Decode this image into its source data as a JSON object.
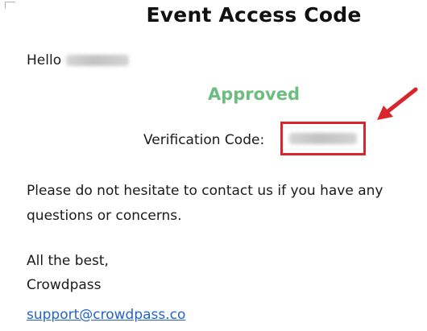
{
  "email": {
    "title": "Event Access Code",
    "greeting": "Hello",
    "recipient_name_redacted": true,
    "status": "Approved",
    "verification_label": "Verification Code:",
    "verification_code_redacted": true,
    "body_line_1": "Please do not hesitate to contact us if you have any",
    "body_line_2": "questions or concerns.",
    "signoff_line_1": "All the best,",
    "signoff_line_2": "Crowdpass",
    "support_email": "support@crowdpass.co"
  },
  "annotations": {
    "highlight_color": "#d8262c",
    "arrow_color": "#d8262c"
  },
  "colors": {
    "status": "#6cbd7f",
    "link": "#2563c7",
    "text": "#1a1a1a"
  }
}
